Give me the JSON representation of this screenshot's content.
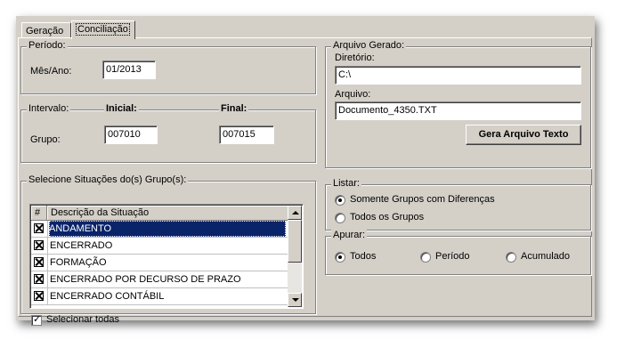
{
  "tabs": [
    {
      "label": "Geração",
      "active": false
    },
    {
      "label": "Conciliação",
      "active": true
    }
  ],
  "periodo": {
    "legend": "Período:",
    "mes_ano_label": "Mês/Ano:",
    "mes_ano_value": "01/2013"
  },
  "intervalo": {
    "legend": "Intervalo:",
    "inicial_label": "Inicial:",
    "final_label": "Final:",
    "grupo_label": "Grupo:",
    "inicial_value": "007010",
    "final_value": "007015"
  },
  "situacoes": {
    "legend": "Selecione Situações do(s) Grupo(s):",
    "columns": [
      "#",
      "Descrição da Situação"
    ],
    "rows": [
      {
        "label": "ANDAMENTO",
        "checked": true,
        "selected": true
      },
      {
        "label": "ENCERRADO",
        "checked": true,
        "selected": false
      },
      {
        "label": "FORMAÇÃO",
        "checked": true,
        "selected": false
      },
      {
        "label": "ENCERRADO POR DECURSO DE PRAZO",
        "checked": true,
        "selected": false
      },
      {
        "label": "ENCERRADO CONTÁBIL",
        "checked": true,
        "selected": false
      }
    ],
    "select_all_label": "Selecionar todas",
    "select_all_checked": true
  },
  "arquivo": {
    "legend": "Arquivo Gerado:",
    "diretorio_label": "Diretório:",
    "diretorio_value": "C:\\",
    "arquivo_label": "Arquivo:",
    "arquivo_value": "Documento_4350.TXT",
    "button_label": "Gera Arquivo Texto"
  },
  "listar": {
    "legend": "Listar:",
    "options": [
      "Somente Grupos com Diferenças",
      "Todos os Grupos"
    ],
    "selected": 0
  },
  "apurar": {
    "legend": "Apurar:",
    "options": [
      "Todos",
      "Período",
      "Acumulado"
    ],
    "selected": 0
  }
}
